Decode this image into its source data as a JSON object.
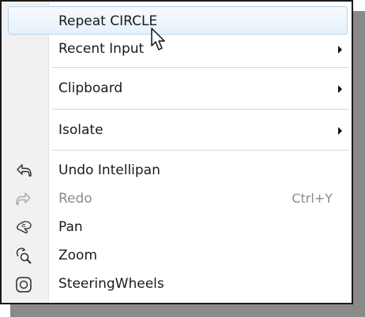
{
  "menu": {
    "items": [
      {
        "label": "Repeat CIRCLE",
        "highlighted": true,
        "has_submenu": false,
        "enabled": true
      },
      {
        "label": "Recent Input",
        "has_submenu": true,
        "enabled": true
      },
      {
        "label": "Clipboard",
        "has_submenu": true,
        "enabled": true
      },
      {
        "label": "Isolate",
        "has_submenu": true,
        "enabled": true
      },
      {
        "label": "Undo Intellipan",
        "icon": "undo-icon",
        "enabled": true
      },
      {
        "label": "Redo",
        "icon": "redo-icon",
        "shortcut": "Ctrl+Y",
        "enabled": false
      },
      {
        "label": "Pan",
        "icon": "pan-hand-icon",
        "enabled": true
      },
      {
        "label": "Zoom",
        "icon": "zoom-magnifier-icon",
        "enabled": true
      },
      {
        "label": "SteeringWheels",
        "icon": "steering-wheel-icon",
        "enabled": true
      }
    ]
  },
  "colors": {
    "highlight_bg": "#e6f1fb",
    "highlight_border": "#b7d4ef",
    "gutter": "#f1f1f1",
    "disabled_text": "#8a8a8a"
  }
}
